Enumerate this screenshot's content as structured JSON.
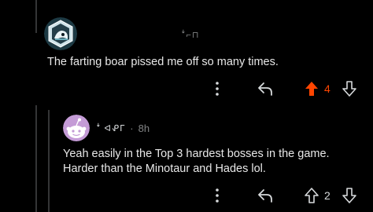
{
  "comment": {
    "username": "ꜜ⌐⊓",
    "body": "The farting boar pissed me off so many times.",
    "vote_count": "4",
    "upvote_color": "#ff4500",
    "vote_count_color": "#ff4500"
  },
  "reply": {
    "username": "ꜜ ᐊᕵᒥ",
    "separator": "·",
    "time": "8h",
    "body_line1": "Yeah easily in the Top 3 hardest bosses in the game.",
    "body_line2": "Harder than the Minotaur and Hades lol.",
    "vote_count": "2",
    "vote_count_color": "#d7dadc"
  },
  "icons": {
    "more": "more-icon",
    "reply": "reply-icon",
    "upvote": "upvote-icon",
    "downvote": "downvote-icon"
  }
}
